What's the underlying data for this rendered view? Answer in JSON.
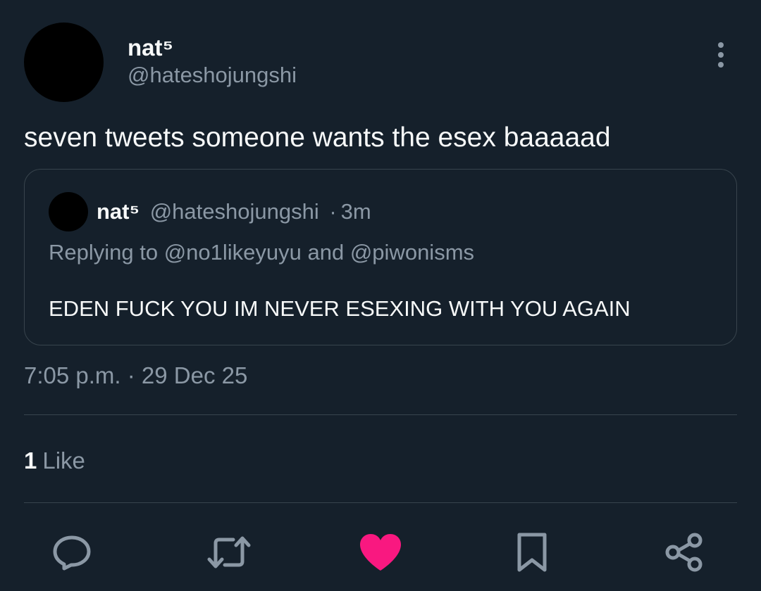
{
  "tweet": {
    "author": {
      "display_name": "nat⁵",
      "handle": "@hateshojungshi"
    },
    "text": "seven tweets someone wants the esex baaaaad",
    "timestamp": "7:05 p.m. · 29 Dec 25",
    "likes_count": "1",
    "likes_label": "Like"
  },
  "quote": {
    "display_name": "nat⁵",
    "handle": "@hateshojungshi",
    "separator": "·",
    "time": "3m",
    "replying_to": "Replying to @no1likeyuyu and @piwonisms",
    "text": "EDEN FUCK YOU IM NEVER ESEXING WITH YOU AGAIN"
  },
  "actions": [
    {
      "icon": "reply-icon"
    },
    {
      "icon": "retweet-icon"
    },
    {
      "icon": "like-icon",
      "active": true,
      "color": "#f91880"
    },
    {
      "icon": "bookmark-icon"
    },
    {
      "icon": "share-icon"
    }
  ],
  "colors": {
    "background": "#15202b",
    "primary_text": "#f7f9f9",
    "secondary_text": "#8b98a5",
    "border": "#38444d",
    "like_active": "#f91880"
  }
}
